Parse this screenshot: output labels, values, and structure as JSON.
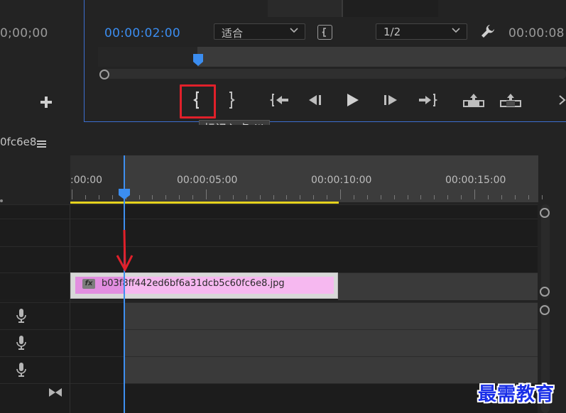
{
  "source_panel": {
    "timecode": "0;00;00"
  },
  "program_monitor": {
    "current_timecode": "00:00:02:00",
    "zoom_select": "适合",
    "resolution_select": "1/2",
    "duration_timecode": "00:00:08",
    "tooltip": "标记入点 (I)",
    "playhead_fraction": 0.25
  },
  "timeline": {
    "sequence_name": "0fc6e8",
    "ruler_labels": [
      ":00:00",
      "00:00:05:00",
      "00:00:10:00",
      "00:00:15:00"
    ],
    "clip": {
      "fx_label": "fx",
      "name": "b03f8ff442ed6bf6a31dcb5c60fc6e8.jpg"
    }
  },
  "watermark": "最需教育",
  "colors": {
    "accent_blue": "#3b8df0",
    "highlight_red": "#e0202a",
    "clip_pink": "#f6b8f0",
    "work_area_yellow": "#e6d31e"
  }
}
